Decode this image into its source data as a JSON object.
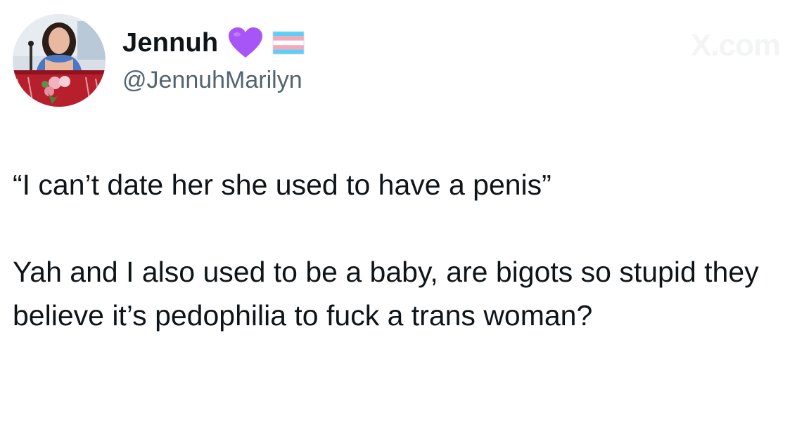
{
  "user": {
    "display_name": "Jennuh",
    "handle": "@JennuhMarilyn",
    "badges": [
      "purple-heart-icon",
      "transgender-flag-icon"
    ]
  },
  "watermark": "X.com",
  "tweet": {
    "line1": "“I can’t date her she used to have a penis”",
    "paragraph2": "Yah and I also used to be a baby, are bigots so stupid they believe it’s pedophilia to fuck a trans woman?"
  },
  "colors": {
    "text": "#0f1419",
    "secondary": "#536471",
    "heart": "#a855f7",
    "flag_blue": "#5bcefa",
    "flag_pink": "#f5a9b8",
    "flag_white": "#ffffff"
  }
}
